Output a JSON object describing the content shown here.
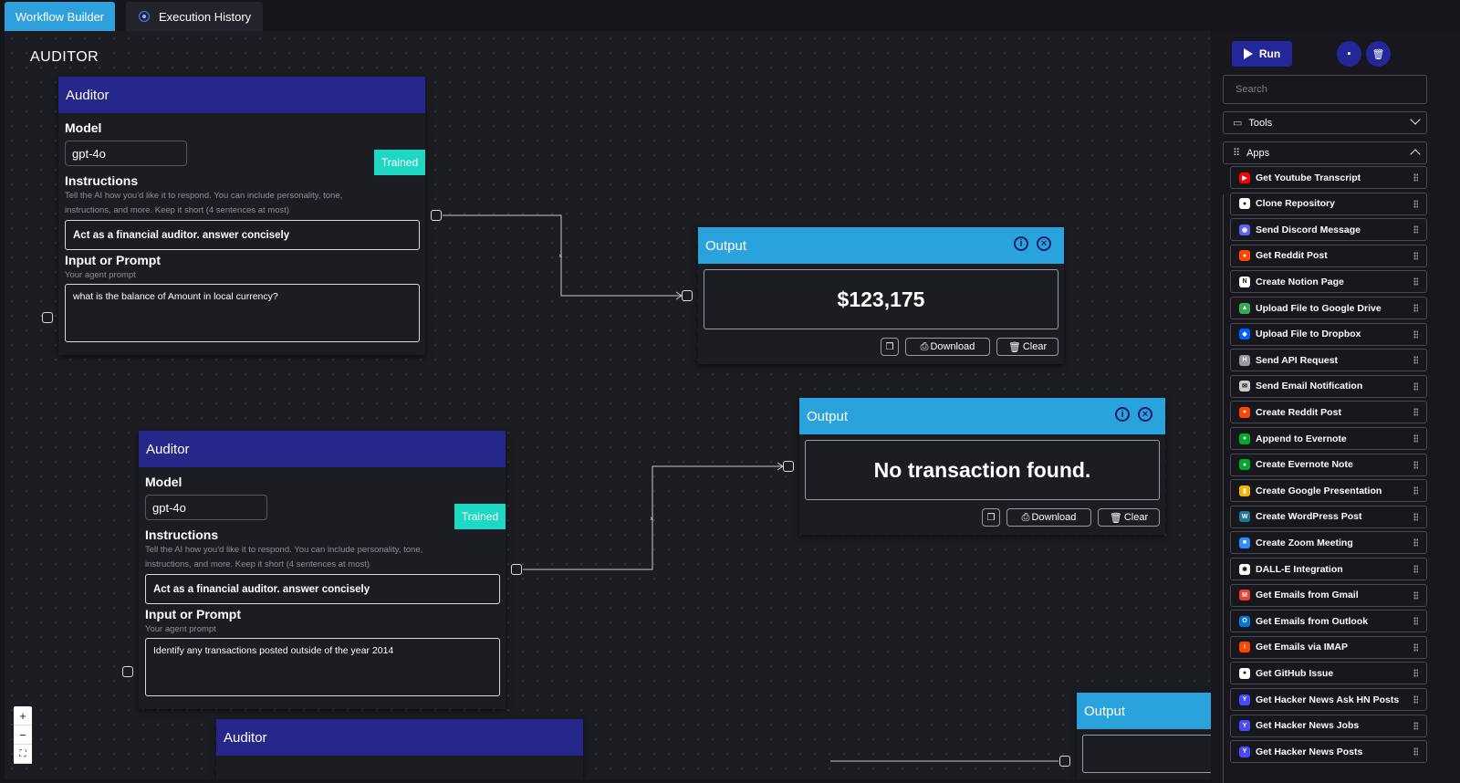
{
  "tabs": [
    {
      "label": "Workflow Builder",
      "active": true
    },
    {
      "label": "Execution History",
      "active": false
    }
  ],
  "canvas": {
    "title": "AUDITOR"
  },
  "auditor_nodes": [
    {
      "header": "Auditor",
      "model_label": "Model",
      "model": "gpt-4o",
      "trained": "Trained",
      "instructions_label": "Instructions",
      "instructions_help_1": "Tell the AI how you'd like it to respond. You can include personality, tone,",
      "instructions_help_2": "instructions, and more. Keep it short (4 sentences at most)",
      "instructions": "Act as a financial auditor. answer concisely",
      "prompt_label": "Input or Prompt",
      "prompt_help": "Your agent prompt",
      "prompt": "what is the balance of Amount in local currency?"
    },
    {
      "header": "Auditor",
      "model_label": "Model",
      "model": "gpt-4o",
      "trained": "Trained",
      "instructions_label": "Instructions",
      "instructions_help_1": "Tell the AI how you'd like it to respond. You can include personality, tone,",
      "instructions_help_2": "instructions, and more. Keep it short (4 sentences at most)",
      "instructions": "Act as a financial auditor. answer concisely",
      "prompt_label": "Input or Prompt",
      "prompt_help": "Your agent prompt",
      "prompt": "Identify any transactions posted outside of the year 2014"
    },
    {
      "header": "Auditor"
    }
  ],
  "output_nodes": [
    {
      "header": "Output",
      "value": "$123,175",
      "download": "Download",
      "clear": "Clear"
    },
    {
      "header": "Output",
      "value": "No transaction found.",
      "download": "Download",
      "clear": "Clear"
    },
    {
      "header": "Output"
    }
  ],
  "zoom": {
    "in": "+",
    "out": "−",
    "fit": "⛶"
  },
  "panel": {
    "run_label": "Run",
    "search_placeholder": "Search",
    "tools_label": "Tools",
    "apps_label": "Apps",
    "apps": [
      {
        "label": "Get Youtube Transcript",
        "icon": "youtube-icon",
        "color": "#ff0000"
      },
      {
        "label": "Clone Repository",
        "icon": "github-icon",
        "color": "#ffffff"
      },
      {
        "label": "Send Discord Message",
        "icon": "discord-icon",
        "color": "#5865f2"
      },
      {
        "label": "Get Reddit Post",
        "icon": "reddit-icon",
        "color": "#ff4500"
      },
      {
        "label": "Create Notion Page",
        "icon": "notion-icon",
        "color": "#ffffff"
      },
      {
        "label": "Upload File to Google Drive",
        "icon": "google-drive-icon",
        "color": "#34a853"
      },
      {
        "label": "Upload File to Dropbox",
        "icon": "dropbox-icon",
        "color": "#0061ff"
      },
      {
        "label": "Send API Request",
        "icon": "http-icon",
        "color": "#9a9aa2"
      },
      {
        "label": "Send Email Notification",
        "icon": "mail-icon",
        "color": "#cccccc"
      },
      {
        "label": "Create Reddit Post",
        "icon": "reddit-icon",
        "color": "#ff4500"
      },
      {
        "label": "Append to Evernote",
        "icon": "evernote-icon",
        "color": "#00a82d"
      },
      {
        "label": "Create Evernote Note",
        "icon": "evernote-icon",
        "color": "#00a82d"
      },
      {
        "label": "Create Google Presentation",
        "icon": "google-slides-icon",
        "color": "#f4b400"
      },
      {
        "label": "Create WordPress Post",
        "icon": "wordpress-icon",
        "color": "#21759b"
      },
      {
        "label": "Create Zoom Meeting",
        "icon": "zoom-icon",
        "color": "#2d8cff"
      },
      {
        "label": "DALL-E Integration",
        "icon": "openai-icon",
        "color": "#ffffff"
      },
      {
        "label": "Get Emails from Gmail",
        "icon": "gmail-icon",
        "color": "#ea4335"
      },
      {
        "label": "Get Emails from Outlook",
        "icon": "outlook-icon",
        "color": "#0078d4"
      },
      {
        "label": "Get Emails via IMAP",
        "icon": "imap-icon",
        "color": "#ff4500"
      },
      {
        "label": "Get GitHub Issue",
        "icon": "github-icon",
        "color": "#ffffff"
      },
      {
        "label": "Get Hacker News Ask HN Posts",
        "icon": "hacker-news-icon",
        "color": "#4a4aff"
      },
      {
        "label": "Get Hacker News Jobs",
        "icon": "hacker-news-icon",
        "color": "#4a4aff"
      },
      {
        "label": "Get Hacker News Posts",
        "icon": "hacker-news-icon",
        "color": "#4a4aff"
      }
    ]
  }
}
